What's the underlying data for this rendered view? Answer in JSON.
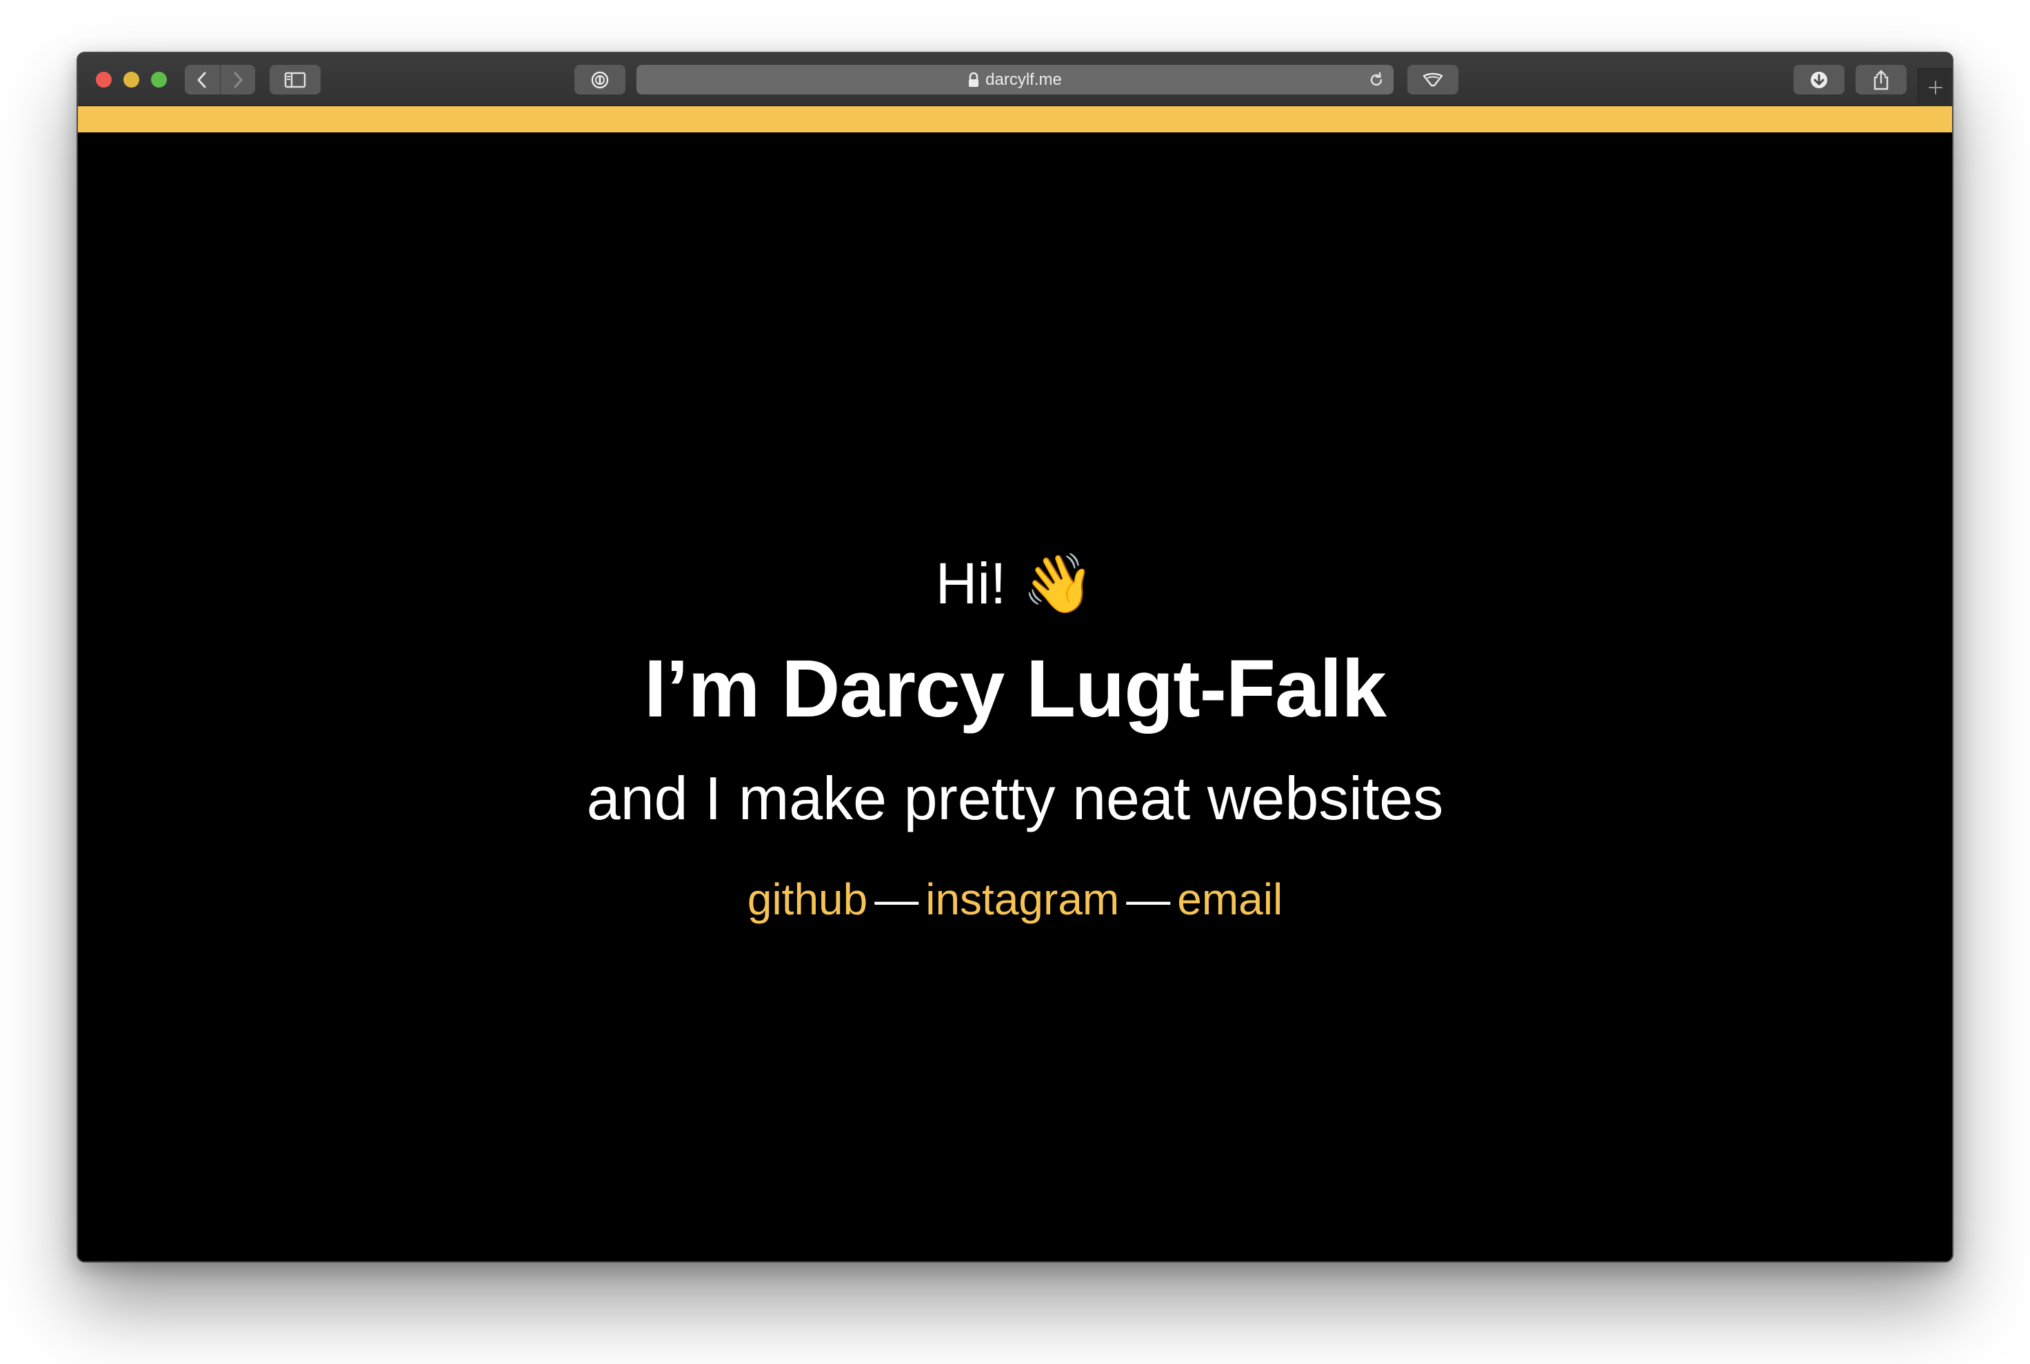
{
  "browser": {
    "url": "darcylf.me"
  },
  "page": {
    "greeting": "Hi!",
    "greeting_emoji": "👋",
    "name": "I’m Darcy Lugt-Falk",
    "tagline": "and I make pretty neat websites",
    "links": [
      {
        "label": "github"
      },
      {
        "label": "instagram"
      },
      {
        "label": "email"
      }
    ],
    "separator": "—"
  },
  "colors": {
    "accent": "#f6c355",
    "background": "#000000",
    "text": "#ffffff"
  },
  "icons": [
    "back-icon",
    "forward-icon",
    "sidebar-icon",
    "password-icon",
    "lock-icon",
    "reload-icon",
    "extension-icon",
    "download-icon",
    "share-icon",
    "plus-icon"
  ]
}
